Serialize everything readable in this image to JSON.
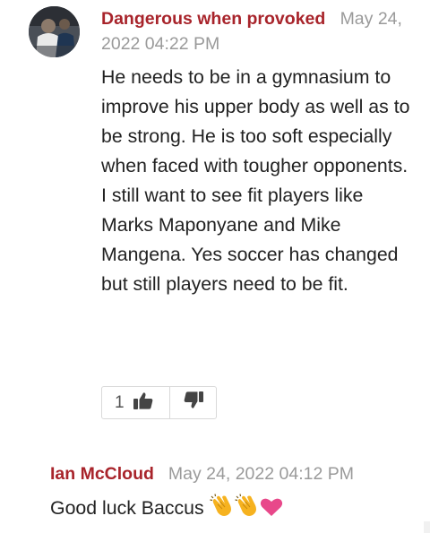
{
  "comments": [
    {
      "author": "Dangerous when provoked",
      "timestamp": "May 24, 2022 04:22 PM",
      "body": "He needs to be in a gymnasium to improve his upper body as well as to be strong. He is too soft especially when faced with tougher opponents. I still want to see fit players like Marks Maponyane and Mike Mangena. Yes soccer has changed but still players need to be fit.",
      "avatar_icon": "user-photo-avatar",
      "votes": {
        "up_count": "1",
        "up_icon": "thumbs-up-icon",
        "down_icon": "thumbs-down-icon"
      }
    },
    {
      "author": "Ian McCloud",
      "timestamp": "May 24, 2022 04:12 PM",
      "body": "Good luck Baccus",
      "emojis": [
        "clapping-hands-icon",
        "clapping-hands-icon",
        "heart-icon"
      ]
    }
  ],
  "colors": {
    "author": "#a8242b",
    "timestamp": "#9a9a9a",
    "text": "#222222",
    "border": "#d9d9d9",
    "icon": "#444444",
    "heart": "#e8488a",
    "clap": "#f6b21f"
  }
}
